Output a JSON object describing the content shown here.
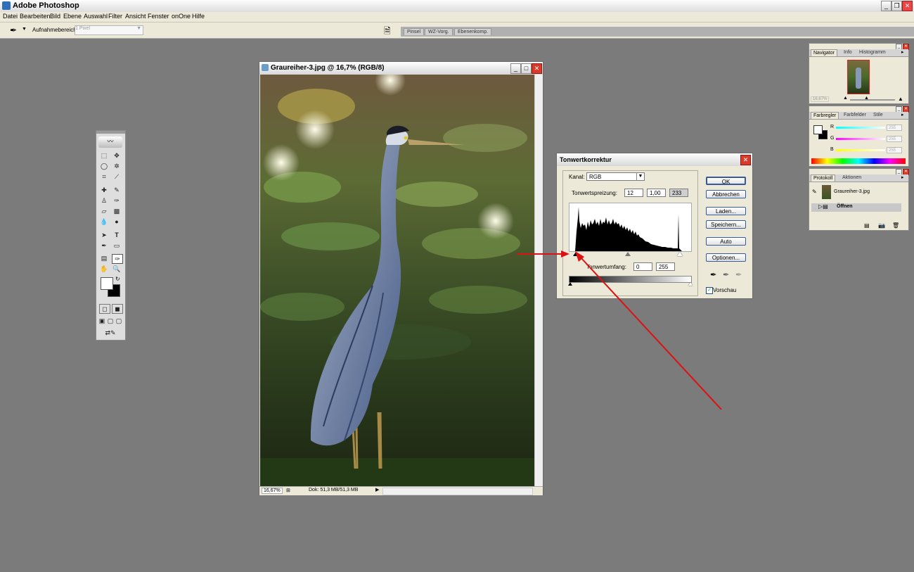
{
  "window": {
    "title": "Adobe Photoshop"
  },
  "menu": [
    "Datei",
    "Bearbeiten",
    "Bild",
    "Ebene",
    "Auswahl",
    "Filter",
    "Ansicht",
    "Fenster",
    "onOne",
    "Hilfe"
  ],
  "options": {
    "label": "Aufnahmebereich:",
    "value": "1 Pixel"
  },
  "palette_well": [
    "Pinsel",
    "WZ-Vorg.",
    "Ebenenkomp."
  ],
  "document": {
    "title": "Graureiher-3.jpg @ 16,7% (RGB/8)",
    "zoom": "16,67%",
    "doc_size": "Dok: 51,3 MB/51,3 MB"
  },
  "dialog": {
    "title": "Tonwertkorrektur",
    "channel_label": "Kanal:",
    "channel_value": "RGB",
    "input_label": "Tonwertspreizung:",
    "input_black": "12",
    "input_gamma": "1,00",
    "input_white": "233",
    "output_label": "Tonwertumfang:",
    "output_black": "0",
    "output_white": "255",
    "buttons": {
      "ok": "OK",
      "cancel": "Abbrechen",
      "load": "Laden...",
      "save": "Speichern...",
      "auto": "Auto",
      "options": "Optionen..."
    },
    "preview_label": "Vorschau",
    "preview_checked": true
  },
  "navigator": {
    "tabs": [
      "Navigator",
      "Info",
      "Histogramm"
    ],
    "zoom": "16,67%"
  },
  "color_panel": {
    "tabs": [
      "Farbregler",
      "Farbfelder",
      "Stile"
    ],
    "channels": [
      {
        "label": "R",
        "value": "255"
      },
      {
        "label": "G",
        "value": "255"
      },
      {
        "label": "B",
        "value": "255"
      }
    ]
  },
  "history": {
    "tabs": [
      "Protokoll",
      "Aktionen"
    ],
    "snapshot": "Graureiher-3.jpg",
    "step": "Öffnen"
  },
  "colors": {
    "accent_red": "#dd1111",
    "title_blue": "#2e6fb8",
    "button_border": "#355aa0"
  }
}
